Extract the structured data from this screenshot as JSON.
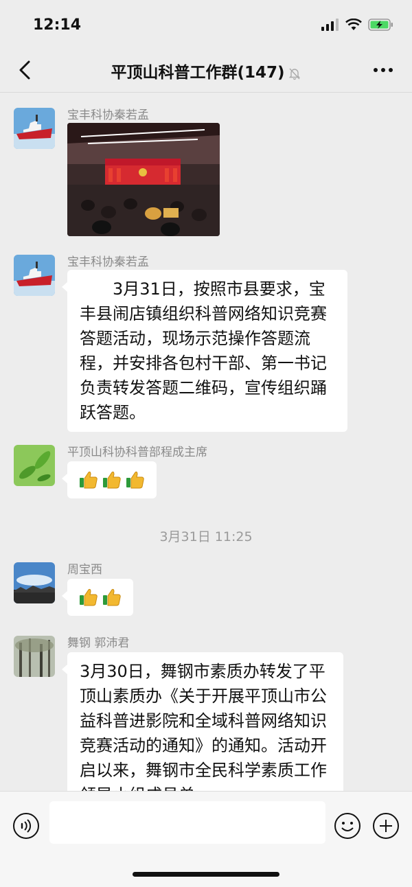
{
  "status": {
    "time": "12:14"
  },
  "header": {
    "title": "平顶山科普工作群",
    "member_count": "(147)"
  },
  "messages": [
    {
      "type": "image",
      "sender": "宝丰科协秦若孟",
      "avatar": "ship-avatar-icon",
      "image": "meeting-hall-photo"
    },
    {
      "type": "text",
      "sender": "宝丰科协秦若孟",
      "avatar": "ship-avatar-icon",
      "text": "　　3月31日，按照市县要求，宝丰县闹店镇组织科普网络知识竞赛答题活动，现场示范操作答题流程，并安排各包村干部、第一书记负责转发答题二维码，宣传组织踊跃答题。"
    },
    {
      "type": "emoji",
      "sender": "平顶山科协科普部程成主席",
      "avatar": "leaf-avatar-icon",
      "emoji": "thumbs-up-icon",
      "emoji_count": 3
    },
    {
      "type": "timestamp",
      "text": "3月31日 11:25"
    },
    {
      "type": "emoji",
      "sender": "周宝西",
      "avatar": "sky-avatar-icon",
      "emoji": "thumbs-up-icon",
      "emoji_count": 2
    },
    {
      "type": "text",
      "sender": "舞钢 郭沛君",
      "avatar": "forest-avatar-icon",
      "text": "3月30日，舞钢市素质办转发了平顶山素质办《关于开展平顶山市公益科普进影院和全域科普网络知识竞赛活动的通知》的通知。活动开启以来，舞钢市全民科学素质工作领导小组成员单"
    }
  ],
  "input": {
    "placeholder": ""
  },
  "colors": {
    "background": "#ededed",
    "bubble": "#ffffff",
    "sender": "#8a8a8a",
    "timestamp": "#9a9a9a",
    "battery": "#4cd964"
  }
}
